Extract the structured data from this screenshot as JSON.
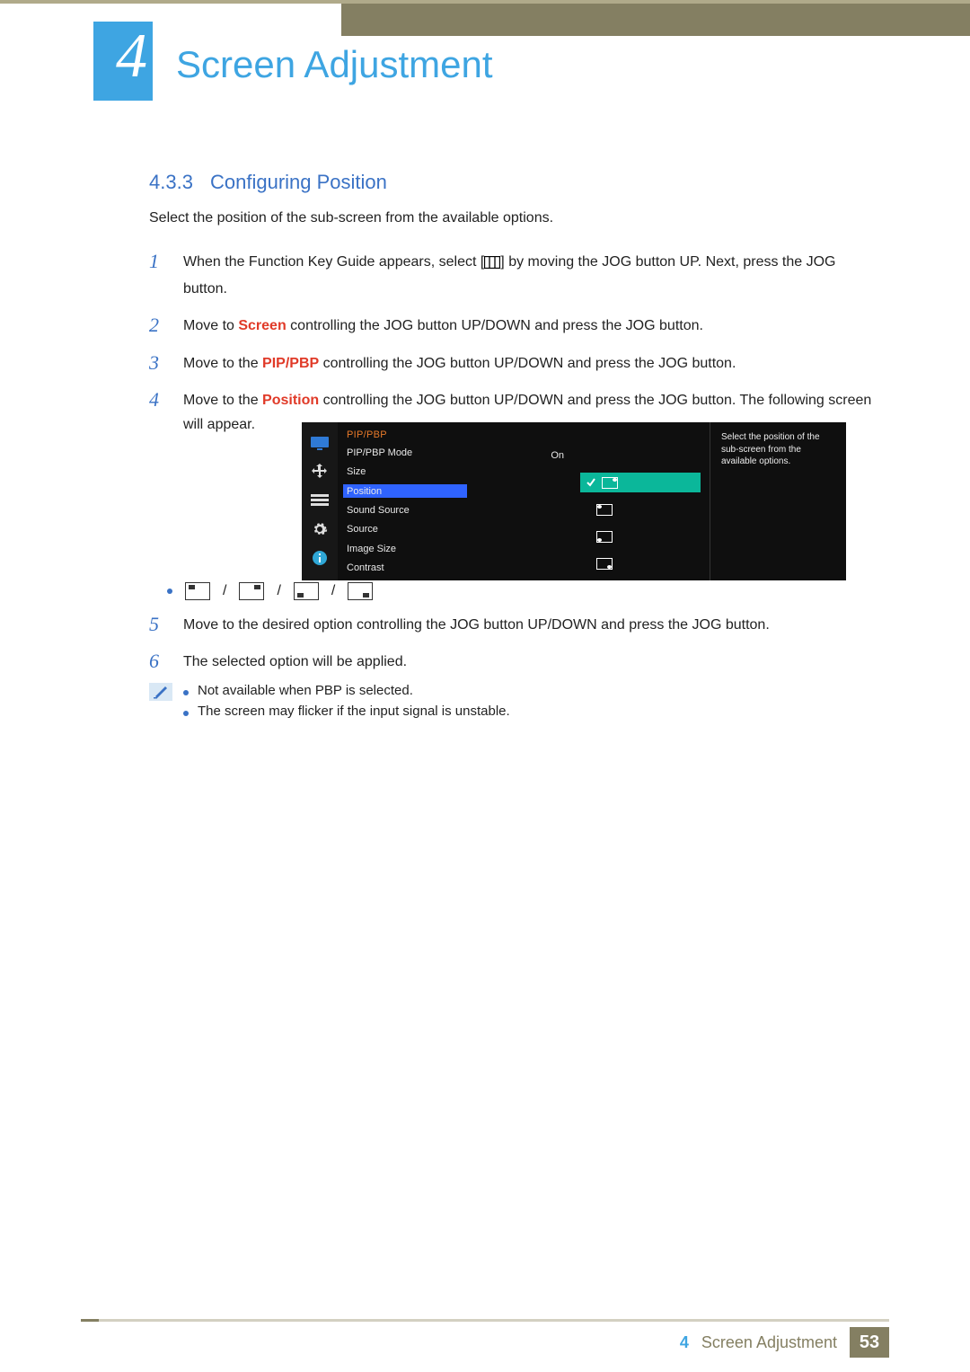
{
  "chapter": {
    "number": "4",
    "title": "Screen Adjustment"
  },
  "section": {
    "number": "4.3.3",
    "title": "Configuring Position"
  },
  "intro": "Select the position of the sub-screen from the available options.",
  "steps": {
    "s1a": "When the Function Key Guide appears, select [",
    "s1b": "] by moving the JOG button UP. Next, press the JOG button.",
    "s2a": "Move to ",
    "s2kw": "Screen",
    "s2b": " controlling the JOG button UP/DOWN and press the JOG button.",
    "s3a": "Move to the ",
    "s3kw": "PIP/PBP",
    "s3b": " controlling the JOG button UP/DOWN and press the JOG button.",
    "s4a": "Move to the ",
    "s4kw": "Position",
    "s4b": " controlling the JOG button UP/DOWN and press the JOG button. The following screen will appear.",
    "s5": "Move to the desired option controlling the JOG button UP/DOWN and press the JOG button.",
    "s6": "The selected option will be applied."
  },
  "osd": {
    "title": "PIP/PBP",
    "items": [
      "PIP/PBP Mode",
      "Size",
      "Position",
      "Sound Source",
      "Source",
      "Image Size",
      "Contrast"
    ],
    "value_on": "On",
    "desc": "Select the position of the sub-screen from the available options."
  },
  "notes": {
    "a": "Not available when PBP is selected.",
    "b": "The screen may flicker if the input signal is unstable."
  },
  "footer": {
    "chapnum": "4",
    "chap": "Screen Adjustment",
    "page": "53"
  },
  "sep": "/"
}
